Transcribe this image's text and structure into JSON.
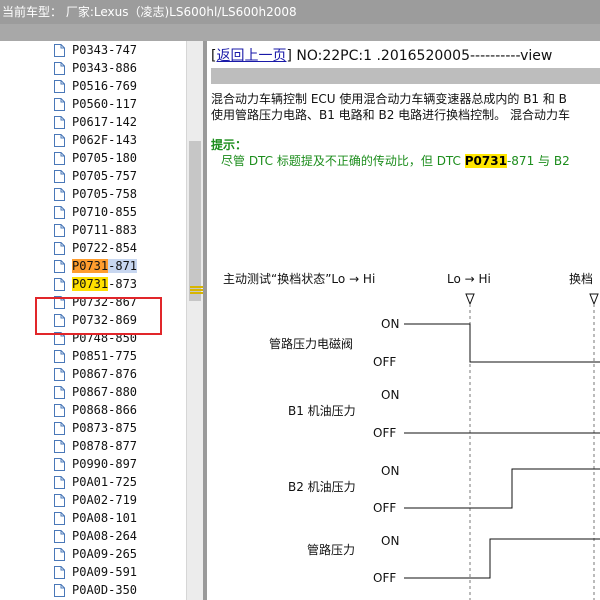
{
  "titlebar": {
    "text": "当前车型：  厂家:Lexus（凌志)LS600hl/LS600h2008"
  },
  "tree": {
    "items": [
      {
        "label": "P0343-747"
      },
      {
        "label": "P0343-886"
      },
      {
        "label": "P0516-769"
      },
      {
        "label": "P0560-117"
      },
      {
        "label": "P0617-142"
      },
      {
        "label": "P062F-143"
      },
      {
        "label": "P0705-180"
      },
      {
        "label": "P0705-757"
      },
      {
        "label": "P0705-758"
      },
      {
        "label": "P0710-855"
      },
      {
        "label": "P0711-883"
      },
      {
        "label": "P0722-854"
      },
      {
        "label": "P0731-871",
        "code": "P0731",
        "suffix": "-871",
        "selected": true
      },
      {
        "label": "P0731-873",
        "code": "P0731",
        "suffix": "-873"
      },
      {
        "label": "P0732-867"
      },
      {
        "label": "P0732-869"
      },
      {
        "label": "P0748-850"
      },
      {
        "label": "P0851-775"
      },
      {
        "label": "P0867-876"
      },
      {
        "label": "P0867-880"
      },
      {
        "label": "P0868-866"
      },
      {
        "label": "P0873-875"
      },
      {
        "label": "P0878-877"
      },
      {
        "label": "P0990-897"
      },
      {
        "label": "P0A01-725"
      },
      {
        "label": "P0A02-719"
      },
      {
        "label": "P0A08-101"
      },
      {
        "label": "P0A08-264"
      },
      {
        "label": "P0A09-265"
      },
      {
        "label": "P0A09-591"
      },
      {
        "label": "P0A0D-350"
      }
    ]
  },
  "content": {
    "back_link": "返回上一页",
    "bracket_open": "[",
    "bracket_close": "]",
    "doc_number": " NO:22PC:1 .2016520005----------view",
    "paragraph_line1": "混合动力车辆控制 ECU 使用混合动力车辆变速器总成内的 B1 和 B",
    "paragraph_line2": "使用管路压力电路、B1 电路和 B2 电路进行换档控制。 混合动力车",
    "hint_title": "提示：",
    "hint_prefix": "尽管 DTC 标题提及不正确的传动比，但 DTC ",
    "hint_code": "P0731",
    "hint_suffix": "-871 与 B2"
  },
  "diagram": {
    "header_label": "主动测试“换档状态”Lo → Hi",
    "marker1_label": "Lo → Hi",
    "marker2_label": "换档",
    "rows": [
      {
        "name": "管路压力电磁阀",
        "on": "ON",
        "off": "OFF"
      },
      {
        "name": "B1 机油压力",
        "on": "ON",
        "off": "OFF"
      },
      {
        "name": "B2 机油压力",
        "on": "ON",
        "off": "OFF"
      },
      {
        "name": "管路压力",
        "on": "ON",
        "off": "OFF"
      }
    ]
  },
  "colors": {
    "highlight_yellow": "#ffe000",
    "highlight_orange": "#ff9d2e",
    "selection_box": "#e1262a",
    "hint_green": "#1c8d1c",
    "link_blue": "#1a1aa8"
  }
}
